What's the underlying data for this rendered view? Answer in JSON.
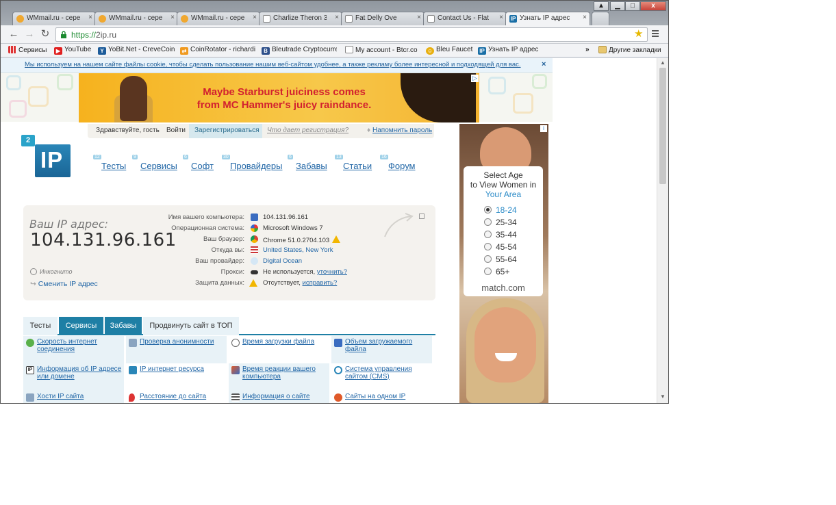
{
  "tabs": [
    {
      "label": "WMmail.ru - cepe",
      "icon": "wmmail-icon"
    },
    {
      "label": "WMmail.ru - cepe",
      "icon": "wmmail-icon"
    },
    {
      "label": "WMmail.ru - cepe",
      "icon": "wmmail-icon"
    },
    {
      "label": "Charlize Theron 3",
      "icon": "page-icon"
    },
    {
      "label": "Fat Delly Ove",
      "icon": "page-icon"
    },
    {
      "label": "Contact Us - Flat",
      "icon": "page-icon"
    },
    {
      "label": "Узнать IP адрес",
      "icon": "ip-icon",
      "active": true
    }
  ],
  "window": {
    "minimize": "▁",
    "maximize": "□",
    "close": "x"
  },
  "toolbar": {
    "url_scheme": "https://",
    "url_host": "2ip.ru"
  },
  "bookmarks": [
    {
      "label": "Сервисы",
      "icon": "apps-icon"
    },
    {
      "label": "YouTube",
      "icon": "youtube-icon"
    },
    {
      "label": "YoBit.Net - CreveCoin",
      "icon": "yobit-icon"
    },
    {
      "label": "CoinRotator - richardi",
      "icon": "coinrotator-icon"
    },
    {
      "label": "Bleutrade Cryptocurre",
      "icon": "bleutrade-icon"
    },
    {
      "label": "My account - Btcr.co",
      "icon": "btcr-icon"
    },
    {
      "label": "Bleu Faucet",
      "icon": "faucet-icon"
    },
    {
      "label": "Узнать IP адрес",
      "icon": "ip-icon"
    }
  ],
  "bookmarks_more": "»",
  "bookmarks_other": "Другие закладки",
  "cookie_text": "Мы используем на нашем сайте файлы cookie, чтобы сделать пользование нашим веб-сайтом удобнее, а также рекламу более интересной и подходящей для вас.",
  "cookie_close": "×",
  "top_ad": {
    "line1": "Maybe Starburst juiciness comes",
    "line2": "from MC Hammer's juicy raindance."
  },
  "login": {
    "greeting": "Здравствуйте, гость",
    "login": "Войти",
    "register": "Зарегистрироваться",
    "why": "Что дает регистрация?",
    "remind": "Напомнить пароль"
  },
  "logo": {
    "badge": "2",
    "text": "IP"
  },
  "nav": [
    {
      "label": "Тесты",
      "count": "12"
    },
    {
      "label": "Сервисы",
      "count": "9"
    },
    {
      "label": "Софт",
      "count": "6"
    },
    {
      "label": "Провайдеры",
      "count": "30"
    },
    {
      "label": "Забавы",
      "count": "6"
    },
    {
      "label": "Статьи",
      "count": "13"
    },
    {
      "label": "Форум",
      "count": "16"
    }
  ],
  "ip_box": {
    "label": "Ваш IP адрес:",
    "value": "104.131.96.161",
    "incognito": "Инкогнито",
    "change_ip": "Сменить IP адрес",
    "rows": [
      {
        "label": "Имя вашего компьютера:",
        "value": "104.131.96.161",
        "icon": "computer-icon"
      },
      {
        "label": "Операционная система:",
        "value": "Microsoft Windows 7",
        "icon": "windows-icon"
      },
      {
        "label": "Ваш браузер:",
        "value": "Chrome 51.0.2704.103",
        "icon": "chrome-icon",
        "warn": true
      },
      {
        "label": "Откуда вы:",
        "value": "United States, New York",
        "icon": "us-flag-icon",
        "link": true
      },
      {
        "label": "Ваш провайдер:",
        "value": "Digital Ocean",
        "icon": "cloud-icon",
        "link": true
      },
      {
        "label": "Прокси:",
        "value": "Не используется,",
        "extra": "уточнить?",
        "icon": "glasses-icon"
      },
      {
        "label": "Защита данных:",
        "value": "Отсутствует,",
        "extra": "исправить?",
        "icon": "warning-icon"
      }
    ]
  },
  "service_tabs": [
    {
      "label": "Тесты",
      "active": false
    },
    {
      "label": "Сервисы",
      "active": true
    },
    {
      "label": "Забавы",
      "active": true
    },
    {
      "label": "Продвинуть сайт в ТОП",
      "active": false
    }
  ],
  "services": [
    {
      "label": "Скорость интернет соединения",
      "icon": "speed-icon"
    },
    {
      "label": "Проверка анонимности",
      "icon": "anonymity-icon"
    },
    {
      "label": "Время загрузки файла",
      "icon": "clock-icon"
    },
    {
      "label": "Объем загружаемого файла",
      "icon": "file-size-icon"
    },
    {
      "label": "Информация об IP адресе или домене",
      "icon": "ip-info-icon"
    },
    {
      "label": "IP интернет ресурса",
      "icon": "ip-resource-icon"
    },
    {
      "label": "Время реакции вашего компьютера",
      "icon": "reaction-icon"
    },
    {
      "label": "Система управления сайтом (CMS)",
      "icon": "cms-icon"
    },
    {
      "label": "Хости IP сайта",
      "icon": "hosting-icon"
    },
    {
      "label": "Расстояние до сайта",
      "icon": "location-pin-icon"
    },
    {
      "label": "Информация о сайте",
      "icon": "site-info-icon"
    },
    {
      "label": "Сайты на одном IP",
      "icon": "sites-same-ip-icon"
    }
  ],
  "side_ad": {
    "title1": "Select Age",
    "title2": "to View Women in",
    "title3": "Your Area",
    "options": [
      {
        "label": "18-24",
        "selected": true
      },
      {
        "label": "25-34",
        "selected": false
      },
      {
        "label": "35-44",
        "selected": false
      },
      {
        "label": "45-54",
        "selected": false
      },
      {
        "label": "55-64",
        "selected": false
      },
      {
        "label": "65+",
        "selected": false
      }
    ],
    "brand": "match.com"
  }
}
